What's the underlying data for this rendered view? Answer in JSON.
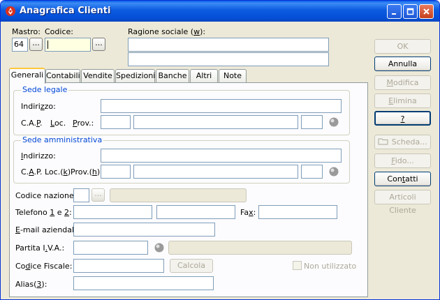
{
  "window": {
    "title": "Anagrafica Clienti",
    "controls": [
      "minimize-icon",
      "maximize-icon",
      "close-icon"
    ]
  },
  "top": {
    "mastro_label": "Mastro:",
    "mastro_value": "64",
    "codice_label": "Codice:",
    "codice_value": "",
    "ragione_label": "Ragione sociale (w):",
    "ellipsis": "..."
  },
  "tabs": [
    {
      "label": "Generali",
      "active": true
    },
    {
      "label": "Contabili"
    },
    {
      "label": "Vendite"
    },
    {
      "label": "Spedizioni"
    },
    {
      "label": "Banche"
    },
    {
      "label": "Altri"
    },
    {
      "label": "Note"
    }
  ],
  "sede_legale": {
    "title": "Sede legale",
    "indirizzo": "Indirizzo:",
    "cap": "C.A.P.",
    "loc": "Loc.",
    "prov": "Prov.:"
  },
  "sede_amm": {
    "title": "Sede amministrativa",
    "indirizzo": "Indirizzo:",
    "cap": "C.A.P.",
    "loc": "Loc.(k)",
    "prov": "Prov.(h):"
  },
  "fields": {
    "codice_nazione": "Codice nazione:",
    "telefono": "Telefono 1 e 2:",
    "fax": "Fax:",
    "email": "E-mail aziendale:",
    "piva": "Partita I.V.A.:",
    "codice_fiscale": "Codice Fiscale:",
    "calcola": "Calcola",
    "non_utilizzato": "Non utilizzato",
    "alias": "Alias(3):"
  },
  "buttons": {
    "ok": "OK",
    "annulla": "Annulla",
    "modifica": "Modifica",
    "elimina": "Elimina",
    "help": "?",
    "scheda": "Scheda...",
    "fido": "Fido...",
    "contatti": "Contatti",
    "articoli": "Articoli Cliente"
  },
  "colors": {
    "titlebar": "#0A5FE8",
    "dialog_bg": "#ECE9D8",
    "group_title": "#0046D5",
    "codice_field": "#FFFFE1"
  }
}
